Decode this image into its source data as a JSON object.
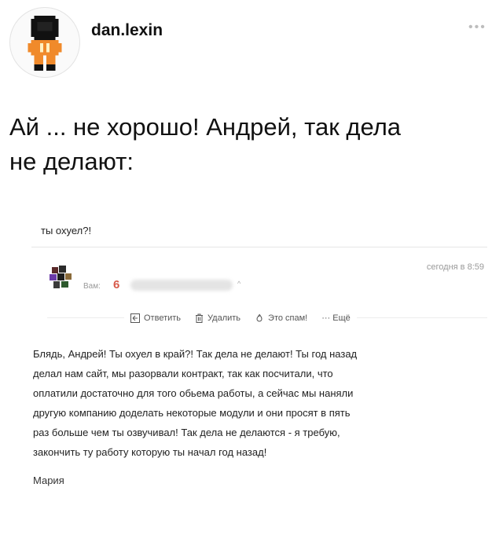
{
  "post": {
    "username": "dan.lexin",
    "text": "Ай ... не хорошо! Андрей, так дела\nне делают:",
    "icons": {
      "avatar": "pixel-astronaut-avatar",
      "more": "more-dots-icon"
    }
  },
  "email": {
    "subject": "ты охуел?!",
    "date": "сегодня в 8:59",
    "to_label": "Вам:",
    "to_mark": "6",
    "to_caret": "^",
    "actions": {
      "reply": "Ответить",
      "delete": "Удалить",
      "spam": "Это спам!",
      "more": "··· Ещё"
    },
    "body": "Блядь, Андрей! Ты охуел в край?! Так дела не делают! Ты год назад\nделал нам сайт, мы разорвали контракт, так как посчитали, что\nоплатили достаточно для того обьема работы, а сейчас мы наняли\nдругую компанию доделать некоторые модули и они просят в пять\nраз больше чем ты озвучивал! Так дела не делаются - я требую,\nзакончить ту работу которую ты начал год назад!",
    "signature": "Мария",
    "colors": {
      "accent_red": "#d85a4a"
    }
  }
}
